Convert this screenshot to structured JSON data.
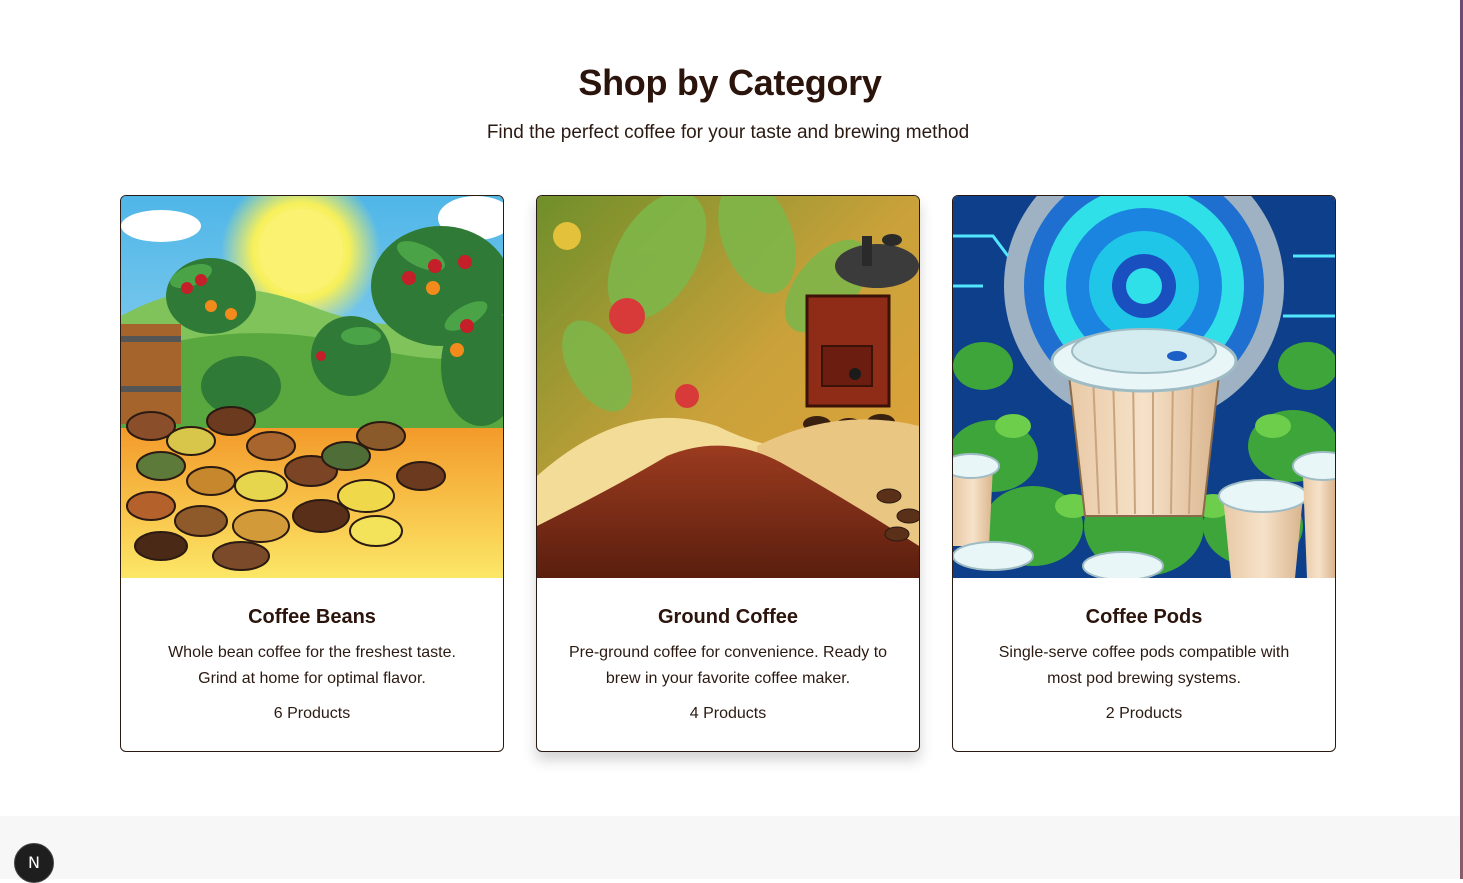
{
  "section": {
    "title": "Shop by Category",
    "subtitle": "Find the perfect coffee for your taste and brewing method"
  },
  "categories": [
    {
      "name": "Coffee Beans",
      "description": "Whole bean coffee for the freshest taste. Grind at home for optimal flavor.",
      "count": "6 Products",
      "image": "coffee-beans-illustration"
    },
    {
      "name": "Ground Coffee",
      "description": "Pre-ground coffee for convenience. Ready to brew in your favorite coffee maker.",
      "count": "4 Products",
      "image": "ground-coffee-illustration"
    },
    {
      "name": "Coffee Pods",
      "description": "Single-serve coffee pods compatible with most pod brewing systems.",
      "count": "2 Products",
      "image": "coffee-pods-illustration"
    }
  ],
  "devtools": {
    "badge": "N",
    "icon": "nextjs-icon"
  },
  "colors": {
    "heading": "#2b140c",
    "text": "#2b1a12",
    "border": "#2b1a12",
    "footer_bg": "#f7f7f7"
  }
}
